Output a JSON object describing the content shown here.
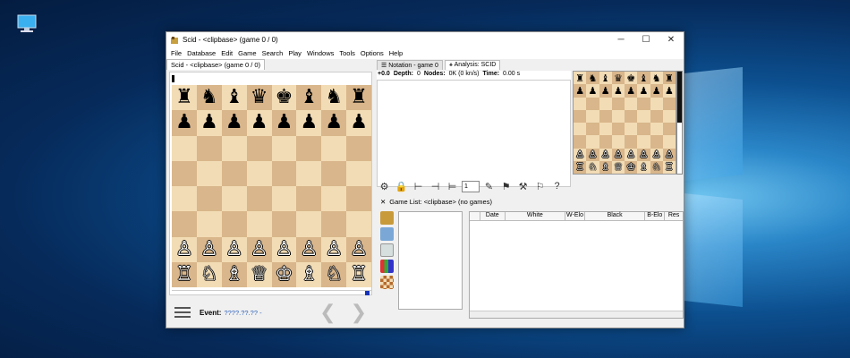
{
  "window": {
    "title": "Scid - <clipbase> (game 0 / 0)",
    "minimize": "─",
    "maximize": "☐",
    "close": "✕"
  },
  "menu": [
    "File",
    "Database",
    "Edit",
    "Game",
    "Search",
    "Play",
    "Windows",
    "Tools",
    "Options",
    "Help"
  ],
  "board_tab": "Scid - <clipbase> (game 0 / 0)",
  "board": {
    "rows": [
      [
        "♜",
        "♞",
        "♝",
        "♛",
        "♚",
        "♝",
        "♞",
        "♜"
      ],
      [
        "♟",
        "♟",
        "♟",
        "♟",
        "♟",
        "♟",
        "♟",
        "♟"
      ],
      [
        "",
        "",
        "",
        "",
        "",
        "",
        "",
        ""
      ],
      [
        "",
        "",
        "",
        "",
        "",
        "",
        "",
        ""
      ],
      [
        "",
        "",
        "",
        "",
        "",
        "",
        "",
        ""
      ],
      [
        "",
        "",
        "",
        "",
        "",
        "",
        "",
        ""
      ],
      [
        "♙",
        "♙",
        "♙",
        "♙",
        "♙",
        "♙",
        "♙",
        "♙"
      ],
      [
        "♖",
        "♘",
        "♗",
        "♕",
        "♔",
        "♗",
        "♘",
        "♖"
      ]
    ]
  },
  "event": {
    "label": "Event:",
    "value": "????.??.?? -"
  },
  "nav": {
    "prev": "❮",
    "next": "❯"
  },
  "notation": {
    "tab_notation": "☰ Notation - game 0",
    "tab_analysis": "⚹ Analysis: SCID",
    "score": "+0.0",
    "depth_label": "Depth:",
    "depth_value": "0",
    "nodes_label": "Nodes:",
    "nodes_value": "0K (0 kn/s)",
    "time_label": "Time:",
    "time_value": "0.00 s",
    "multipv_value": "1"
  },
  "gamelist": {
    "title": "Game List: <clipbase> (no games)",
    "columns": [
      "Date",
      "White",
      "W-Elo",
      "Black",
      "B-Elo",
      "Res"
    ]
  },
  "colors": {
    "light_square": "#f2dcb5",
    "dark_square": "#d9b68b",
    "desktop_accent": "#2a86c8"
  }
}
